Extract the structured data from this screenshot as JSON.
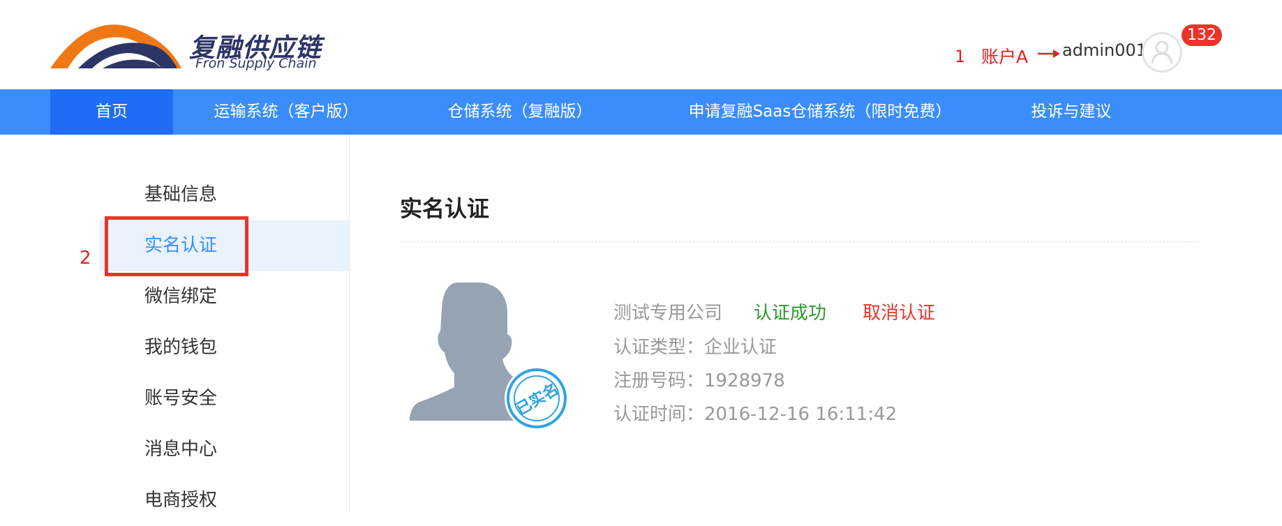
{
  "header": {
    "logo_cn": "复融供应链",
    "logo_en": "Fron Supply Chain",
    "annotation_1": "1",
    "account_label": "账户A",
    "username": "admin001",
    "badge_count": "132"
  },
  "nav": {
    "items": [
      {
        "label": "首页",
        "active": true
      },
      {
        "label": "运输系统（客户版）"
      },
      {
        "label": "仓储系统（复融版）"
      },
      {
        "label": "申请复融Saas仓储系统（限时免费）"
      },
      {
        "label": "投诉与建议"
      }
    ]
  },
  "sidebar": {
    "annotation_2": "2",
    "items": [
      {
        "label": "基础信息"
      },
      {
        "label": "实名认证",
        "active": true
      },
      {
        "label": "微信绑定"
      },
      {
        "label": "我的钱包"
      },
      {
        "label": "账号安全"
      },
      {
        "label": "消息中心"
      },
      {
        "label": "电商授权"
      }
    ]
  },
  "main": {
    "title": "实名认证",
    "stamp_text": "已实名",
    "company": "测试专用公司",
    "status": "认证成功",
    "cancel_label": "取消认证",
    "cert_type": "认证类型：企业认证",
    "reg_number": "注册号码：1928978",
    "cert_time": "认证时间：2016-12-16 16:11:42"
  },
  "colors": {
    "nav_bg": "#3a8dfb",
    "nav_active_bg": "#1f6cf6",
    "accent_blue": "#3a8dfb",
    "success_green": "#2a9b2a",
    "danger_red": "#e8352a",
    "logo_orange": "#f07814",
    "logo_navy": "#2c3566"
  },
  "icons": {
    "logo": "bridge-arc-logo-icon",
    "arrow": "right-arrow-icon",
    "avatar": "user-avatar-icon",
    "photo": "person-silhouette-icon",
    "stamp": "verified-stamp-icon"
  }
}
